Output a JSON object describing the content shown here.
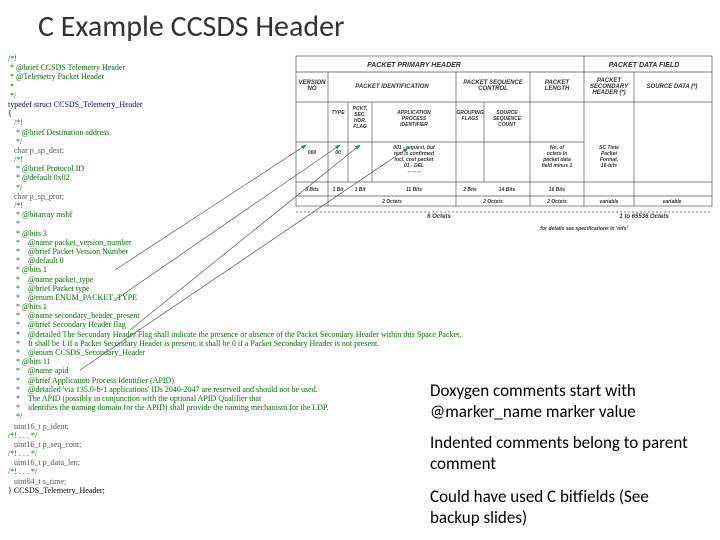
{
  "title": "C Example CCSDS Header",
  "code": {
    "block1_open": "/*!",
    "block1_l1": " * @brief CCSDS Telemetry Header",
    "block1_l2": " * @Telemetry Packet Header",
    "block1_l3": " *",
    "block1_close": " */",
    "typedef_kw": "typedef struct ",
    "typedef_name": "CCSDS_Telemetry_Header",
    "brace_open": "{",
    "dest_open": "   /*!",
    "dest_l1": "    * @brief Destination address",
    "dest_close": "    */",
    "dest_type": "   char ",
    "dest_name": "p_sp_dest",
    "dest_semi": ";",
    "prot_open": "   /*!",
    "prot_l1": "    * @brief Protocol ID",
    "prot_l2": "    * @default 0x02",
    "prot_close": "    */",
    "prot_type": "   char ",
    "prot_name": "p_sp_prot",
    "prot_semi": ";",
    "bits_open": "   /*!",
    "bits_l1": "    * @bitarray msbf",
    "bits_l2": "    *",
    "bits_l3": "    * @bits 3",
    "bits_l4": "    *    @name packet_version_number",
    "bits_l5": "    *    @brief Packet Version Number",
    "bits_l6": "    *    @default 0",
    "bits_l7": "    * @bits 1",
    "bits_l8": "    *    @name packet_type",
    "bits_l9": "    *    @brief Packet type",
    "bits_l10": "    *    @enum ENUM_PACKET_TYPE",
    "bits_l11": "    * @bits 1",
    "bits_l12": "    *    @name secondary_header_present",
    "bits_l13": "    *    @brief Secondary Header flag",
    "bits_l14": "    *    @detailed The Secondary Header Flag shall indicate the presence or absence of the Packet Secondary Header within this Space Packet.",
    "bits_l15": "    *    It shall be 1 if a Packet Secondary Header is present; it shall be 0 if a Packet Secondary Header is not present.",
    "bits_l16": "    *    @enum CCSDS_Secondary_Header",
    "bits_l17": "    * @bits 11",
    "bits_l18": "    *    @name apid",
    "bits_l19": "    *    @brief Application Process Identifier (APID)",
    "bits_l20": "    *    @detailed 'via 135.0-b-1 applications' IDs 2040-2047 are reserved and should not be used.",
    "bits_l21": "    *    The APID (possibly in conjunction with the optional APID Qualifier that",
    "bits_l22": "    *    identifies the naming domain for the APID) shall provide the naming mechanism for the LDP.",
    "bits_close": "    */",
    "fld1": "   uint16_t p_ident;",
    "gap1": "/*! . . . */",
    "fld2": "   uint16_t p_seq_cont;",
    "gap2": "/*! . . . */",
    "fld3": "   uint16_t p_data_len;",
    "gap3": "/*! . . . */",
    "fld4": "   uint64_t s_time;",
    "close": "} CCSDS_Telemetry_Header;"
  },
  "table": {
    "hdr_primary": "PACKET PRIMARY HEADER",
    "hdr_datafield": "PACKET DATA FIELD",
    "col_version": "VERSION\nNO",
    "col_pktid": "PACKET IDENTIFICATION",
    "col_seqctrl": "PACKET SEQUENCE\nCONTROL",
    "col_pktlen": "PACKET\nLENGTH",
    "col_sechdr": "PACKET\nSECONDARY\nHEADER (*)",
    "col_srcdata": "SOURCE DATA (*)",
    "sub_type": "TYPE",
    "sub_pckt": "PCKT.\nSEC.\nHDR.\nFLAG",
    "sub_apid": "APPLICATION\nPROCESS\nIDENTIFIER",
    "sub_grping": "GROUPING\nFLAGS",
    "sub_srccnt": "SOURCE\nSEQUENCE\nCOUNT",
    "note_00": "00",
    "note_000": "000",
    "note_cost": "001 - request, but\ntext is confirmed\nincl. cost packet\n01 - DEL\n-- -- --",
    "note_sctime": "SC Time\nPacket\nFormat,\n16-bits",
    "note_noof": "No. of\noctets in\npacket data\nfield minus 1",
    "bits_ver": "3 Bits",
    "bits_type": "1 Bit",
    "bits_flag": "1 Bit",
    "bits_apid": "11 Bits",
    "bits_grp": "2 Bits",
    "bits_cnt": "14 Bits",
    "bits_len": "16 Bits",
    "w_2oct": "2 Octets",
    "w_var": "variable",
    "w_var2": "variable",
    "footer": "6 Octets",
    "footer2": "1 to 65536 Octets",
    "note_spec": "for details see specifications in 'refs' "
  },
  "annotations": {
    "a1": "Doxygen comments start with @marker_name marker value",
    "a2": "Indented comments belong to parent comment",
    "a3": "Could have used C bitfields (See backup slides)"
  }
}
